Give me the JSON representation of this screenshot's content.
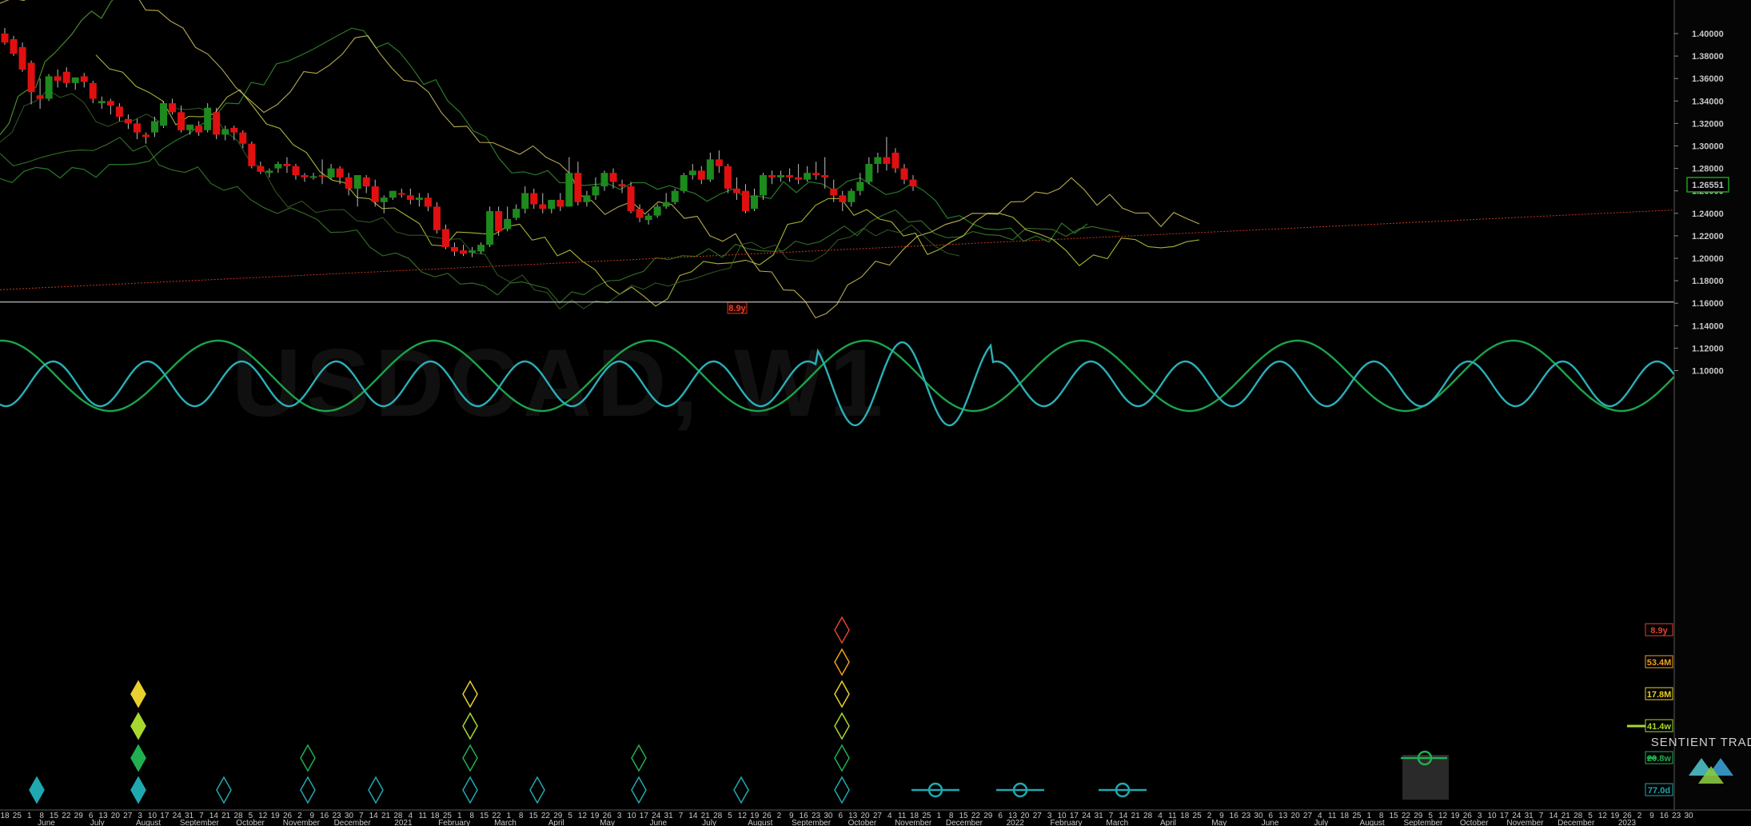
{
  "chart_data": {
    "type": "candlestick",
    "symbol": "USDCAD, W1",
    "ylim": [
      1.065,
      1.415
    ],
    "y_ticks": [
      "1.40000",
      "1.38000",
      "1.36000",
      "1.34000",
      "1.32000",
      "1.30000",
      "1.28000",
      "1.26000",
      "1.24000",
      "1.22000",
      "1.20000",
      "1.18000",
      "1.16000",
      "1.14000",
      "1.12000",
      "1.10000"
    ],
    "current_price": "1.26551",
    "trendline_label": "8.9y",
    "cycle_labels": [
      {
        "text": "8.9y",
        "color": "#e0452d"
      },
      {
        "text": "53.4M",
        "color": "#f0a020"
      },
      {
        "text": "17.8M",
        "color": "#e8d030"
      },
      {
        "text": "41.4w",
        "color": "#a8d830"
      },
      {
        "text": "20.8w",
        "color": "#20b050"
      },
      {
        "text": "77.0d",
        "color": "#20a8b0"
      }
    ],
    "x_day_labels": [
      "18",
      "25",
      "1",
      "8",
      "15",
      "22",
      "29",
      "6",
      "13",
      "20",
      "27",
      "3",
      "10",
      "17",
      "24",
      "31",
      "7",
      "14",
      "21",
      "28",
      "5",
      "12",
      "19",
      "26",
      "2",
      "9",
      "16",
      "23",
      "30",
      "7",
      "14",
      "21",
      "28",
      "4",
      "11",
      "18",
      "25",
      "1",
      "8",
      "15",
      "22",
      "1",
      "8",
      "15",
      "22",
      "29",
      "5",
      "12",
      "19",
      "26",
      "3",
      "10",
      "17",
      "24",
      "31",
      "7",
      "14",
      "21",
      "28",
      "5",
      "12",
      "19",
      "26",
      "2",
      "9",
      "16",
      "23",
      "30",
      "6",
      "13",
      "20",
      "27",
      "4",
      "11",
      "18",
      "25",
      "1",
      "8",
      "15",
      "22",
      "29",
      "6",
      "13",
      "20",
      "27",
      "3",
      "10",
      "17",
      "24",
      "31",
      "7",
      "14",
      "21",
      "28",
      "4",
      "11",
      "18",
      "25",
      "2",
      "9",
      "16",
      "23",
      "30",
      "6",
      "13",
      "20",
      "27",
      "4",
      "11",
      "18",
      "25",
      "1",
      "8",
      "15",
      "22",
      "29",
      "5",
      "12",
      "19",
      "26",
      "3",
      "10",
      "17",
      "24",
      "31",
      "7",
      "14",
      "21",
      "28",
      "5",
      "12",
      "19",
      "26",
      "2",
      "9",
      "16",
      "23",
      "30"
    ],
    "x_month_labels": [
      "June",
      "July",
      "August",
      "September",
      "October",
      "November",
      "December",
      "2021",
      "February",
      "March",
      "April",
      "May",
      "June",
      "July",
      "August",
      "September",
      "October",
      "November",
      "December",
      "2022",
      "February",
      "March",
      "April",
      "May",
      "June",
      "July",
      "August",
      "September",
      "October",
      "November",
      "December",
      "2023"
    ],
    "candles": [
      [
        1.4,
        1.405,
        1.392,
        1.39
      ],
      [
        1.395,
        1.398,
        1.382,
        1.38
      ],
      [
        1.388,
        1.392,
        1.368,
        1.366
      ],
      [
        1.374,
        1.376,
        1.348,
        1.337
      ],
      [
        1.345,
        1.36,
        1.342,
        1.333
      ],
      [
        1.342,
        1.364,
        1.362,
        1.34
      ],
      [
        1.362,
        1.368,
        1.358,
        1.352
      ],
      [
        1.366,
        1.37,
        1.356,
        1.352
      ],
      [
        1.356,
        1.36,
        1.361,
        1.35
      ],
      [
        1.362,
        1.365,
        1.357,
        1.352
      ],
      [
        1.356,
        1.358,
        1.342,
        1.338
      ],
      [
        1.338,
        1.344,
        1.34,
        1.333
      ],
      [
        1.34,
        1.342,
        1.336,
        1.328
      ],
      [
        1.335,
        1.338,
        1.326,
        1.322
      ],
      [
        1.324,
        1.328,
        1.32,
        1.315
      ],
      [
        1.32,
        1.324,
        1.312,
        1.306
      ],
      [
        1.31,
        1.312,
        1.308,
        1.302
      ],
      [
        1.312,
        1.326,
        1.322,
        1.308
      ],
      [
        1.318,
        1.34,
        1.338,
        1.316
      ],
      [
        1.338,
        1.342,
        1.33,
        1.328
      ],
      [
        1.33,
        1.336,
        1.314,
        1.312
      ],
      [
        1.314,
        1.318,
        1.319,
        1.31
      ],
      [
        1.318,
        1.322,
        1.312,
        1.309
      ],
      [
        1.314,
        1.338,
        1.334,
        1.312
      ],
      [
        1.33,
        1.334,
        1.31,
        1.306
      ],
      [
        1.31,
        1.318,
        1.315,
        1.305
      ],
      [
        1.316,
        1.318,
        1.312,
        1.305
      ],
      [
        1.312,
        1.314,
        1.302,
        1.298
      ],
      [
        1.302,
        1.304,
        1.282,
        1.28
      ],
      [
        1.282,
        1.286,
        1.277,
        1.275
      ],
      [
        1.276,
        1.28,
        1.278,
        1.272
      ],
      [
        1.28,
        1.286,
        1.284,
        1.276
      ],
      [
        1.284,
        1.29,
        1.282,
        1.276
      ],
      [
        1.282,
        1.284,
        1.274,
        1.27
      ],
      [
        1.274,
        1.276,
        1.272,
        1.268
      ],
      [
        1.272,
        1.276,
        1.273,
        1.27
      ],
      [
        1.274,
        1.288,
        1.273,
        1.266
      ],
      [
        1.272,
        1.284,
        1.28,
        1.27
      ],
      [
        1.28,
        1.282,
        1.272,
        1.266
      ],
      [
        1.272,
        1.276,
        1.262,
        1.256
      ],
      [
        1.262,
        1.274,
        1.274,
        1.246
      ],
      [
        1.272,
        1.274,
        1.264,
        1.258
      ],
      [
        1.264,
        1.27,
        1.25,
        1.246
      ],
      [
        1.25,
        1.256,
        1.254,
        1.24
      ],
      [
        1.254,
        1.26,
        1.26,
        1.252
      ],
      [
        1.258,
        1.262,
        1.257,
        1.254
      ],
      [
        1.256,
        1.262,
        1.252,
        1.248
      ],
      [
        1.252,
        1.258,
        1.254,
        1.246
      ],
      [
        1.254,
        1.258,
        1.246,
        1.242
      ],
      [
        1.246,
        1.25,
        1.225,
        1.222
      ],
      [
        1.226,
        1.23,
        1.21,
        1.208
      ],
      [
        1.21,
        1.214,
        1.206,
        1.202
      ],
      [
        1.207,
        1.212,
        1.204,
        1.202
      ],
      [
        1.205,
        1.21,
        1.207,
        1.201
      ],
      [
        1.206,
        1.214,
        1.212,
        1.204
      ],
      [
        1.212,
        1.246,
        1.242,
        1.21
      ],
      [
        1.242,
        1.246,
        1.224,
        1.22
      ],
      [
        1.226,
        1.246,
        1.235,
        1.224
      ],
      [
        1.236,
        1.248,
        1.244,
        1.234
      ],
      [
        1.244,
        1.264,
        1.258,
        1.24
      ],
      [
        1.258,
        1.262,
        1.248,
        1.244
      ],
      [
        1.248,
        1.258,
        1.244,
        1.24
      ],
      [
        1.244,
        1.252,
        1.252,
        1.24
      ],
      [
        1.252,
        1.258,
        1.246,
        1.242
      ],
      [
        1.246,
        1.29,
        1.276,
        1.246
      ],
      [
        1.276,
        1.286,
        1.25,
        1.247
      ],
      [
        1.25,
        1.26,
        1.256,
        1.246
      ],
      [
        1.256,
        1.272,
        1.264,
        1.252
      ],
      [
        1.264,
        1.278,
        1.276,
        1.26
      ],
      [
        1.276,
        1.28,
        1.268,
        1.262
      ],
      [
        1.266,
        1.27,
        1.264,
        1.258
      ],
      [
        1.264,
        1.268,
        1.242,
        1.24
      ],
      [
        1.244,
        1.248,
        1.236,
        1.232
      ],
      [
        1.234,
        1.24,
        1.238,
        1.23
      ],
      [
        1.238,
        1.248,
        1.246,
        1.236
      ],
      [
        1.246,
        1.258,
        1.25,
        1.244
      ],
      [
        1.25,
        1.262,
        1.26,
        1.248
      ],
      [
        1.26,
        1.276,
        1.274,
        1.258
      ],
      [
        1.274,
        1.284,
        1.278,
        1.27
      ],
      [
        1.278,
        1.282,
        1.27,
        1.266
      ],
      [
        1.27,
        1.294,
        1.288,
        1.268
      ],
      [
        1.288,
        1.296,
        1.282,
        1.276
      ],
      [
        1.282,
        1.284,
        1.262,
        1.258
      ],
      [
        1.262,
        1.272,
        1.258,
        1.252
      ],
      [
        1.26,
        1.266,
        1.242,
        1.24
      ],
      [
        1.244,
        1.262,
        1.256,
        1.242
      ],
      [
        1.256,
        1.276,
        1.274,
        1.252
      ],
      [
        1.274,
        1.278,
        1.272,
        1.266
      ],
      [
        1.272,
        1.278,
        1.274,
        1.268
      ],
      [
        1.274,
        1.28,
        1.272,
        1.268
      ],
      [
        1.272,
        1.284,
        1.27,
        1.266
      ],
      [
        1.27,
        1.282,
        1.276,
        1.268
      ],
      [
        1.276,
        1.286,
        1.274,
        1.27
      ],
      [
        1.274,
        1.29,
        1.272,
        1.262
      ],
      [
        1.262,
        1.27,
        1.256,
        1.25
      ],
      [
        1.256,
        1.26,
        1.25,
        1.242
      ],
      [
        1.25,
        1.262,
        1.26,
        1.246
      ],
      [
        1.26,
        1.276,
        1.268,
        1.256
      ],
      [
        1.268,
        1.29,
        1.284,
        1.266
      ],
      [
        1.284,
        1.294,
        1.29,
        1.276
      ],
      [
        1.29,
        1.308,
        1.284,
        1.278
      ],
      [
        1.294,
        1.298,
        1.28,
        1.276
      ],
      [
        1.28,
        1.284,
        1.27,
        1.266
      ],
      [
        1.27,
        1.274,
        1.264,
        1.26
      ]
    ],
    "trendline": {
      "from": [
        -1,
        1.172
      ],
      "to": [
        1500,
        1.243
      ]
    },
    "horizontal_level": 1.161,
    "cycle_markers_top": [
      {
        "x": 173,
        "colors": [
          "#e8d030",
          "#a8d830",
          "#20b050",
          "#20a8b0"
        ],
        "filled": true
      },
      {
        "x": 588,
        "colors": [
          "#e8d030",
          "#a8d830",
          "#20b050",
          "#20a8b0"
        ],
        "filled": false
      },
      {
        "x": 385,
        "colors": [
          "#20b050",
          "#20a8b0"
        ],
        "filled": false
      },
      {
        "x": 799,
        "colors": [
          "#20b050",
          "#20a8b0"
        ],
        "filled": false
      },
      {
        "x": 1053,
        "colors": [
          "#e0452d",
          "#f0a020",
          "#e8d030",
          "#a8d830",
          "#20b050",
          "#20a8b0"
        ],
        "filled": false
      }
    ],
    "cycle_markers_single": [
      46,
      280,
      470,
      672,
      927
    ],
    "future_markers": [
      1170,
      1276,
      1404
    ],
    "logo": "SENTIENT TRADER"
  }
}
